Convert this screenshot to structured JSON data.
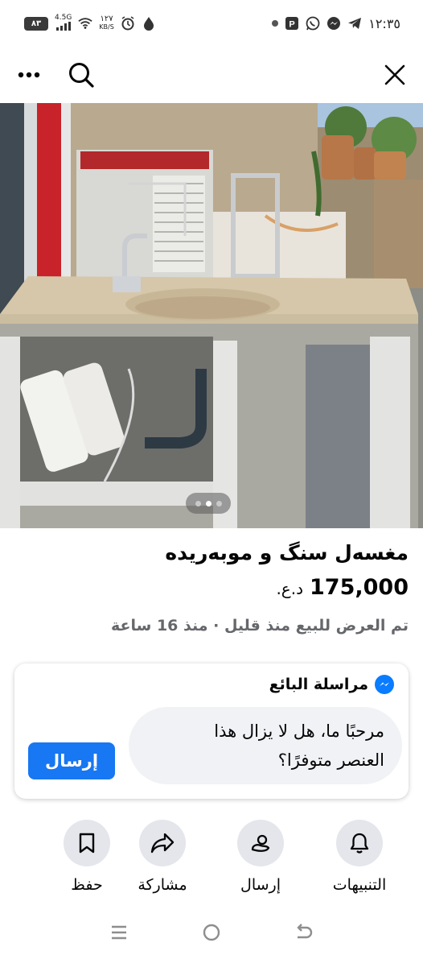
{
  "status_bar": {
    "battery": "٨٣",
    "network": "4.5G",
    "speed_value": "١٢٧",
    "speed_unit": "KB/S",
    "time": "١٢:٣٥",
    "icons": [
      "signal-icon",
      "wifi-icon",
      "alarm-icon",
      "data-saver-icon",
      "notification-dot-icon",
      "parking-icon",
      "whatsapp-icon",
      "messenger-icon",
      "telegram-icon"
    ]
  },
  "top_bar": {
    "icons": [
      "more-options-icon",
      "search-icon",
      "close-icon"
    ]
  },
  "photo": {
    "current_index": 2,
    "total": 3
  },
  "listing": {
    "title": "مغسەل سنگ و موبەریدە",
    "price": "175,000",
    "currency": "د.ع.",
    "meta": "تم العرض للبيع منذ قليل · منذ 16 ساعة"
  },
  "message_card": {
    "title": "مراسلة البائع",
    "message_line1": "مرحبًا ما، هل لا يزال هذا",
    "message_line2": "العنصر متوفرًا؟",
    "send_label": "إرسال"
  },
  "actions": [
    {
      "label": "التنبيهات",
      "icon": "bell-icon"
    },
    {
      "label": "إرسال",
      "icon": "messenger-send-icon"
    },
    {
      "label": "مشاركة",
      "icon": "share-icon"
    },
    {
      "label": "حفظ",
      "icon": "bookmark-icon"
    }
  ],
  "nav_bar": {
    "icons": [
      "recent-apps-icon",
      "home-icon",
      "back-icon"
    ]
  },
  "colors": {
    "accent": "#1877f2",
    "messenger": "#0a7cff",
    "meta_text": "#65676b",
    "action_circle": "#e4e6eb",
    "bubble": "#f0f2f5"
  }
}
